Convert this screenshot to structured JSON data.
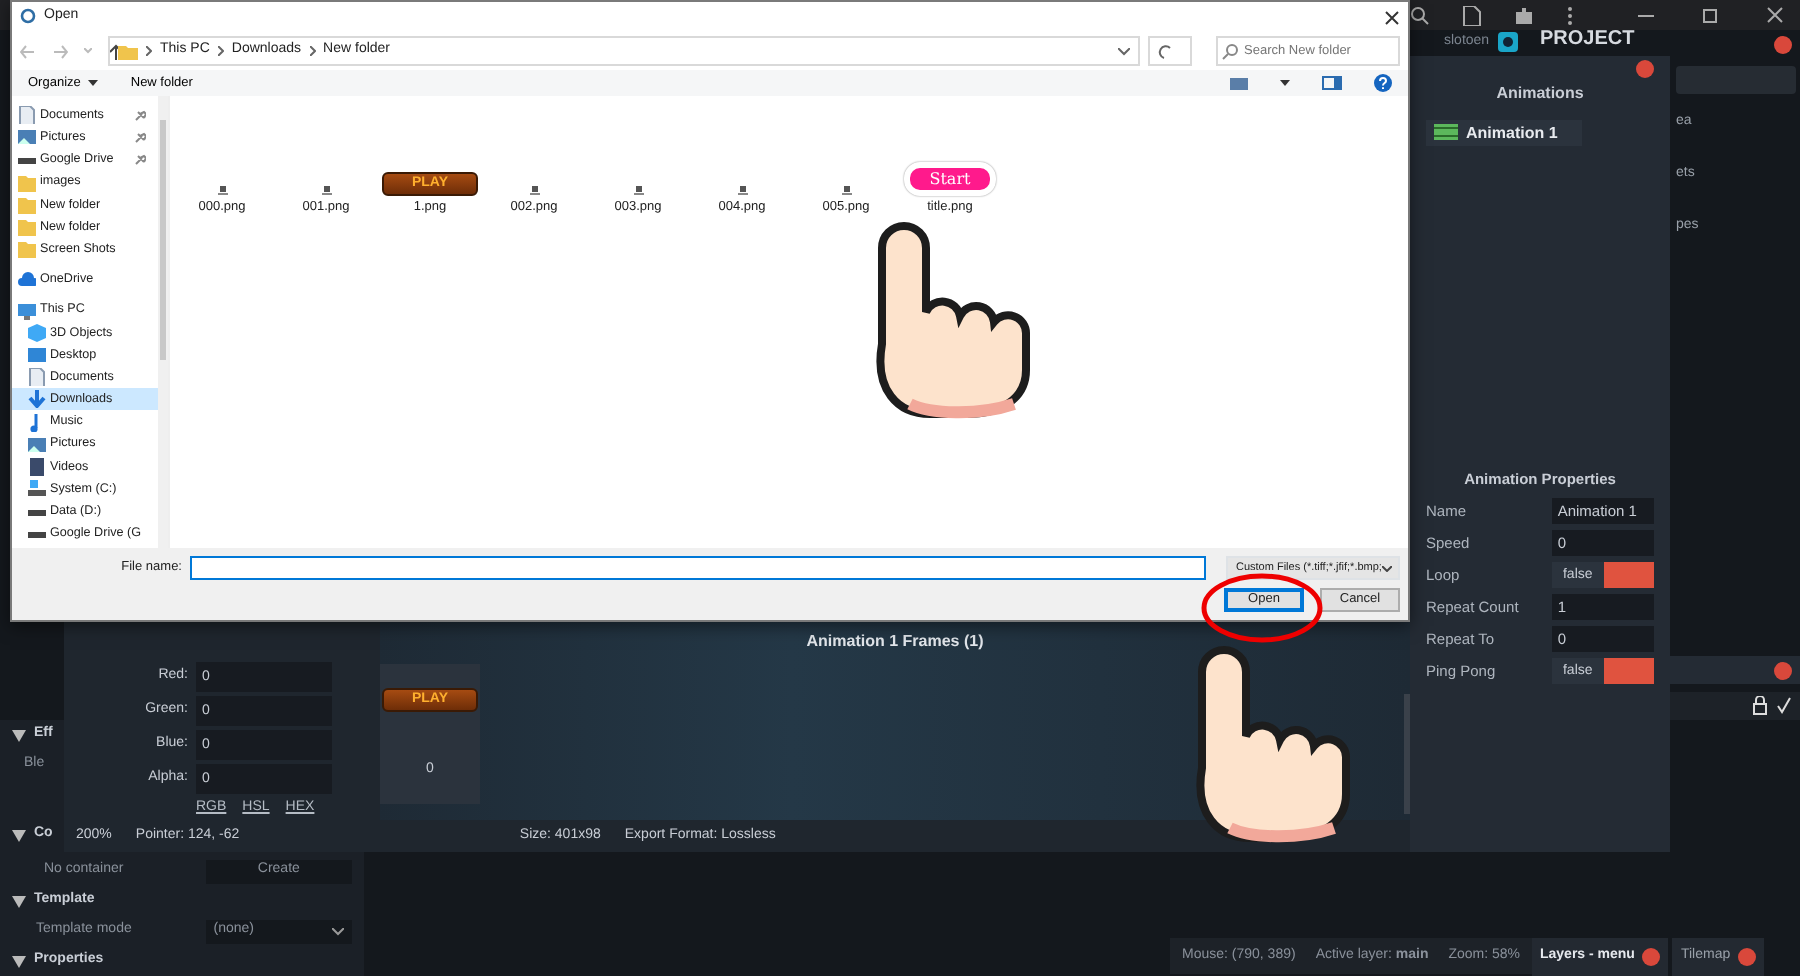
{
  "app": {
    "logo_text": "slotoen",
    "project_title": "PROJECT",
    "project_items": [
      "ea",
      "ets",
      "pes"
    ],
    "left_panel": [
      {
        "kind": "section",
        "label": "Eff",
        "expanded": true
      },
      {
        "kind": "row",
        "label": "Ble"
      },
      {
        "kind": "section",
        "label": "Co",
        "expanded": true
      },
      {
        "kind": "row_button",
        "label": "No container",
        "button": "Create"
      },
      {
        "kind": "section",
        "label": "Template",
        "expanded": true
      },
      {
        "kind": "row_select",
        "label": "Template mode",
        "value": "(none)"
      },
      {
        "kind": "section",
        "label": "Properties",
        "expanded": true
      }
    ],
    "status": {
      "mouse": "Mouse: (790, 389)",
      "layer": "Active layer: **main**",
      "zoom": "Zoom: 58%"
    },
    "bottom_tabs": [
      {
        "label": "Layers - menu",
        "selected": true
      },
      {
        "label": "Tilemap",
        "selected": false
      }
    ]
  },
  "animation_window": {
    "animations_title": "Animations",
    "animations": [
      {
        "name": "Animation 1",
        "selected": true
      }
    ],
    "frames_title": "Animation 1 Frames (1)",
    "frames": [
      {
        "thumb_text": "PLAY",
        "index": "0"
      }
    ],
    "color_fields": [
      {
        "label": "Red:",
        "value": "0"
      },
      {
        "label": "Green:",
        "value": "0"
      },
      {
        "label": "Blue:",
        "value": "0"
      },
      {
        "label": "Alpha:",
        "value": "0"
      }
    ],
    "color_modes": [
      "RGB",
      "HSL",
      "HEX"
    ],
    "zoom": "200%",
    "pointer": "Pointer: 124, -62",
    "size": "Size: 401x98",
    "export": "Export Format: Lossless",
    "properties_title": "Animation Properties",
    "properties": [
      {
        "label": "Name",
        "kind": "text",
        "value": "Animation 1"
      },
      {
        "label": "Speed",
        "kind": "text",
        "value": "0"
      },
      {
        "label": "Loop",
        "kind": "toggle",
        "value": "false",
        "on": false
      },
      {
        "label": "Repeat Count",
        "kind": "text",
        "value": "1"
      },
      {
        "label": "Repeat To",
        "kind": "text",
        "value": "0"
      },
      {
        "label": "Ping Pong",
        "kind": "toggle",
        "value": "false",
        "on": false
      }
    ]
  },
  "dialog": {
    "title": "Open",
    "breadcrumb": [
      "This PC",
      "Downloads",
      "New folder"
    ],
    "search": {
      "placeholder": "Search New folder"
    },
    "toolbar": [
      "Organize",
      "New folder"
    ],
    "sidebar": [
      {
        "label": "Documents",
        "kind": "doc",
        "pinned": true,
        "selected": false
      },
      {
        "label": "Pictures",
        "kind": "picture",
        "pinned": true,
        "selected": false
      },
      {
        "label": "Google Drive",
        "kind": "drive",
        "pinned": true,
        "selected": false
      },
      {
        "label": "images",
        "kind": "folder",
        "pinned": false,
        "selected": false
      },
      {
        "label": "New folder",
        "kind": "folder",
        "pinned": false,
        "selected": false
      },
      {
        "label": "New folder",
        "kind": "folder",
        "pinned": false,
        "selected": false
      },
      {
        "label": "Screen Shots",
        "kind": "folder",
        "pinned": false,
        "selected": false
      },
      {
        "label": "OneDrive",
        "kind": "cloud",
        "pinned": false,
        "selected": false
      },
      {
        "label": "This PC",
        "kind": "pc",
        "pinned": false,
        "selected": false,
        "children": [
          {
            "label": "3D Objects",
            "kind": "cube",
            "pinned": false,
            "selected": false
          },
          {
            "label": "Desktop",
            "kind": "desktop",
            "pinned": false,
            "selected": false
          },
          {
            "label": "Documents",
            "kind": "doc",
            "pinned": false,
            "selected": false
          },
          {
            "label": "Downloads",
            "kind": "download",
            "pinned": false,
            "selected": true
          },
          {
            "label": "Music",
            "kind": "music",
            "pinned": false,
            "selected": false
          },
          {
            "label": "Pictures",
            "kind": "picture",
            "pinned": false,
            "selected": false
          },
          {
            "label": "Videos",
            "kind": "video",
            "pinned": false,
            "selected": false
          },
          {
            "label": "System (C:)",
            "kind": "system",
            "pinned": false,
            "selected": false
          },
          {
            "label": "Data (D:)",
            "kind": "drive",
            "pinned": false,
            "selected": false
          },
          {
            "label": "Google Drive (G",
            "kind": "drive",
            "pinned": false,
            "selected": false
          }
        ]
      }
    ],
    "files": [
      {
        "name": "000.png",
        "kind": "sprite"
      },
      {
        "name": "001.png",
        "kind": "sprite"
      },
      {
        "name": "1.png",
        "kind": "button",
        "thumb_text": "PLAY"
      },
      {
        "name": "002.png",
        "kind": "sprite"
      },
      {
        "name": "003.png",
        "kind": "sprite"
      },
      {
        "name": "004.png",
        "kind": "sprite"
      },
      {
        "name": "005.png",
        "kind": "sprite"
      },
      {
        "name": "title.png",
        "kind": "pill",
        "thumb_text": "Start"
      }
    ],
    "file_name_label": "File name:",
    "file_type": "Custom Files (*.tiff;*.jfif;*.bmp;",
    "buttons": [
      {
        "label": "Open",
        "kind": "default"
      },
      {
        "label": "Cancel",
        "kind": "normal"
      }
    ]
  }
}
